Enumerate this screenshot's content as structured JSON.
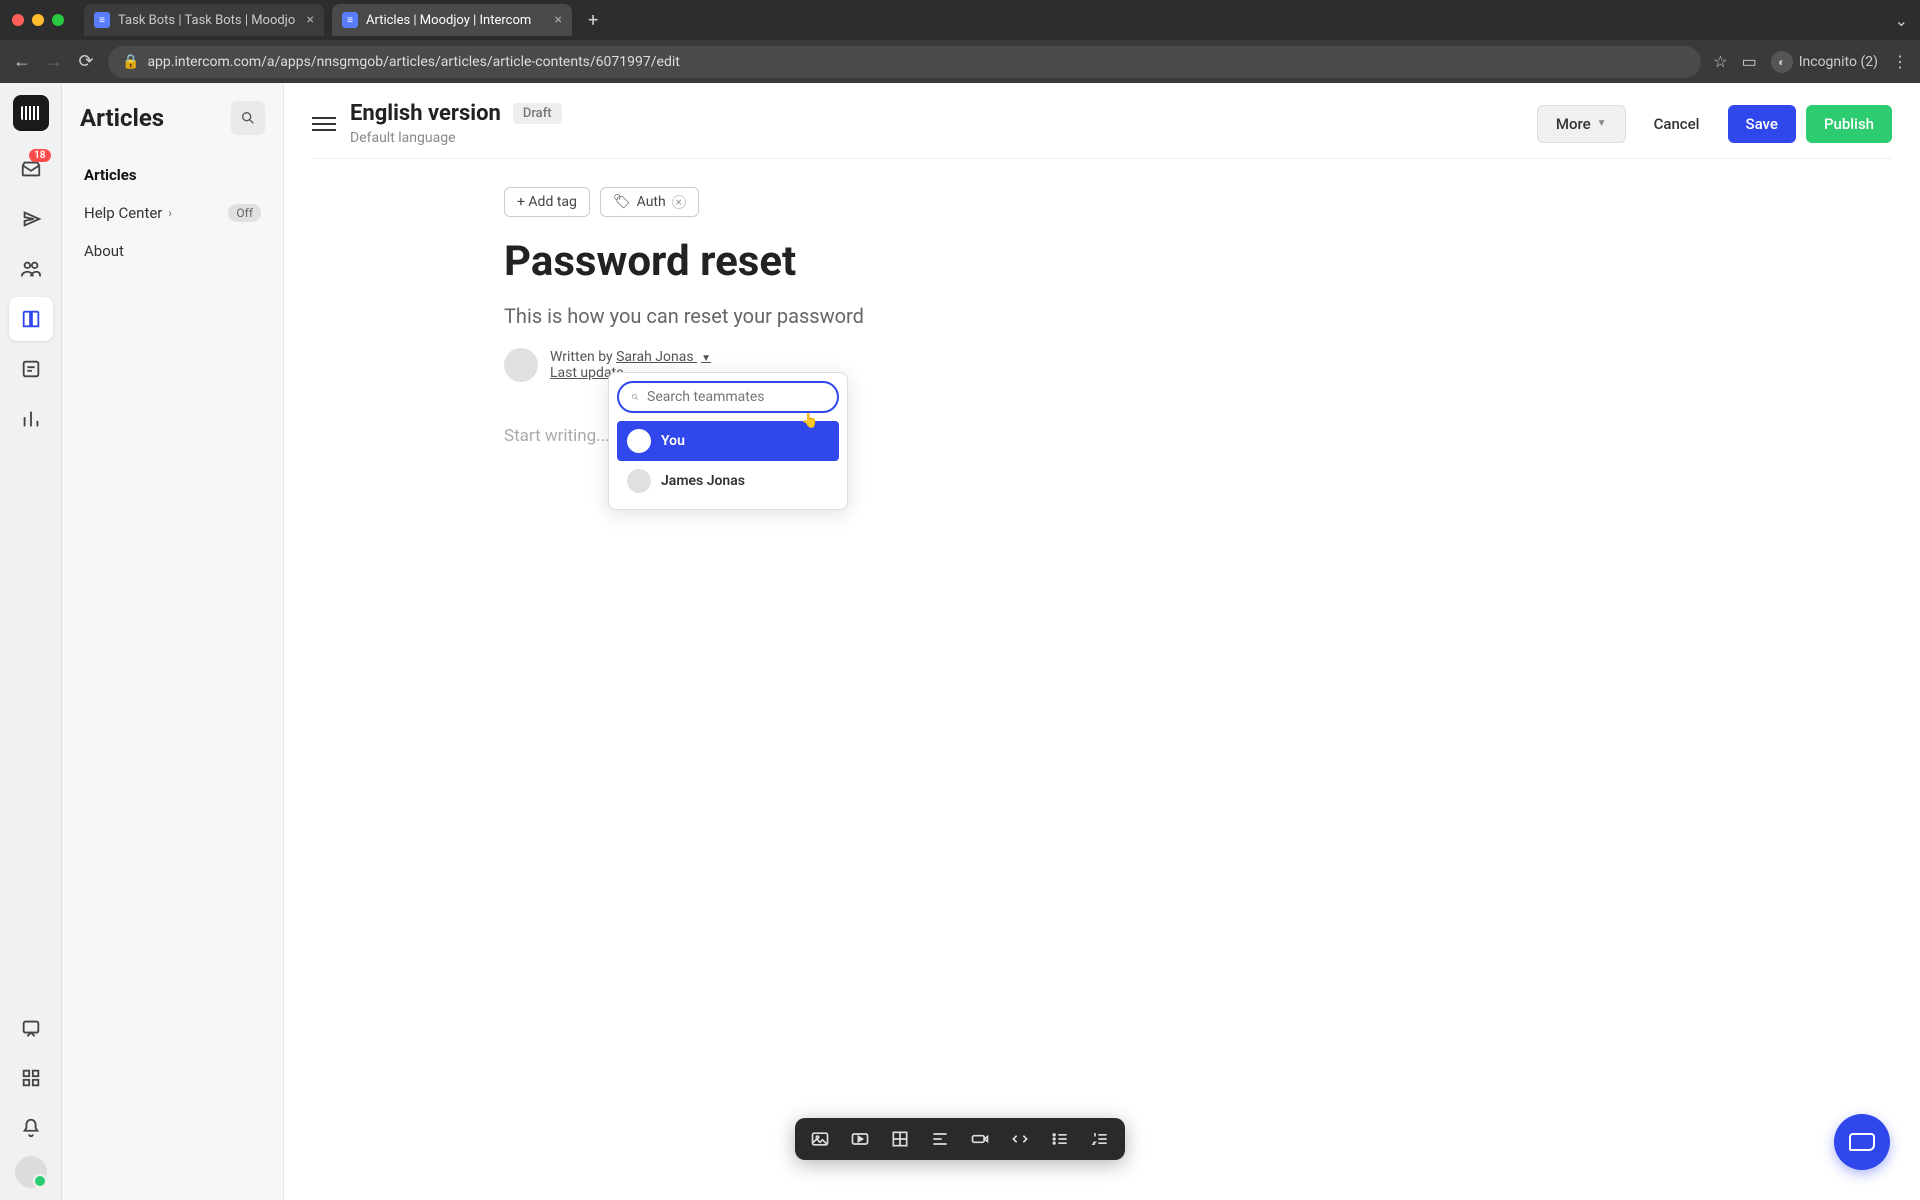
{
  "browser": {
    "tabs": [
      {
        "title": "Task Bots | Task Bots | Moodjo"
      },
      {
        "title": "Articles | Moodjoy | Intercom"
      }
    ],
    "url": "app.intercom.com/a/apps/nnsgmgob/articles/articles/article-contents/6071997/edit",
    "incognito_label": "Incognito (2)"
  },
  "rail": {
    "inbox_badge": "18"
  },
  "sidebar": {
    "title": "Articles",
    "items": [
      {
        "label": "Articles",
        "active": true
      },
      {
        "label": "Help Center",
        "chevron": true,
        "badge": "Off"
      },
      {
        "label": "About"
      }
    ]
  },
  "editor": {
    "header": {
      "title": "English version",
      "status": "Draft",
      "subtitle": "Default language",
      "actions": {
        "more": "More",
        "cancel": "Cancel",
        "save": "Save",
        "publish": "Publish"
      }
    },
    "tags": {
      "add_label": "+ Add tag",
      "items": [
        {
          "label": "Auth"
        }
      ]
    },
    "article": {
      "title": "Password reset",
      "description": "This is how you can reset your password",
      "author_prefix": "Written by ",
      "author_name": "Sarah Jonas",
      "last_updated_label": "Last update",
      "body_placeholder": "Start writing..."
    },
    "teammate_dropdown": {
      "search_placeholder": "Search teammates",
      "options": [
        {
          "name": "You",
          "highlighted": true
        },
        {
          "name": "James Jonas",
          "highlighted": false
        }
      ]
    }
  }
}
